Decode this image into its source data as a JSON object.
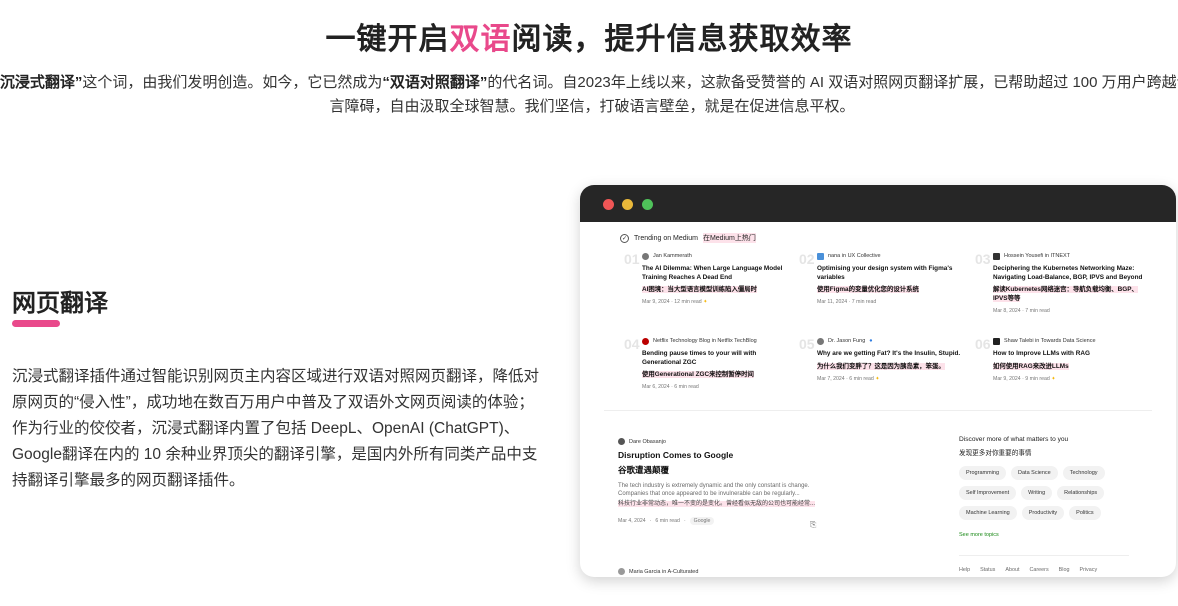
{
  "hero": {
    "title_a": "一键开启",
    "title_hl": "双语",
    "title_b": "阅读，提升信息获取效率",
    "desc_q1": "“沉浸式翻译”",
    "desc_1": "这个词，由我们发明创造。如今，它已然成为",
    "desc_q2": "“双语对照翻译”",
    "desc_2": "的代名词。自2023年上线以来，这款备受赞誉的 AI 双语对照网页翻译扩展，已帮助超过 100 万用户跨越语言障碍，自由汲取全球智慧。我们坚信，打破语言壁垒，就是在促进信息平权。"
  },
  "feature": {
    "title": "网页翻译",
    "desc": "沉浸式翻译插件通过智能识别网页主内容区域进行双语对照网页翻译，降低对原网页的“侵入性”，成功地在数百万用户中普及了双语外文网页阅读的体验；作为行业的佼佼者，沉浸式翻译内置了包括 DeepL、OpenAI (ChatGPT)、Google翻译在内的 10 余种业界顶尖的翻译引擎，是国内外所有同类产品中支持翻译引擎最多的网页翻译插件。",
    "accent_color": "#e9498b"
  },
  "browser": {
    "trending_label": "Trending on Medium",
    "trending_trans": "在Medium上热门",
    "posts": [
      {
        "num": "01",
        "author": "Jan Kammerath",
        "title": "The AI Dilemma: When Large Language Model Training Reaches A Dead End",
        "trans": "AI困境：当大型语言模型训练陷入僵局时",
        "meta": "Mar 9, 2024 · 12 min read"
      },
      {
        "num": "02",
        "author": "nana in UX Collective",
        "title": "Optimising your design system with Figma's variables",
        "trans": "使用Figma的变量优化您的设计系统",
        "meta": "Mar 11, 2024 · 7 min read"
      },
      {
        "num": "03",
        "author": "Hossein Yousefi in ITNEXT",
        "title": "Deciphering the Kubernetes Networking Maze: Navigating Load-Balance, BGP, IPVS and Beyond",
        "trans": "解读Kubernetes网络迷宫：导航负载均衡、BGP、IPVS等等",
        "meta": "Mar 8, 2024 · 7 min read"
      },
      {
        "num": "04",
        "author": "Netflix Technology Blog in Netflix TechBlog",
        "title": "Bending pause times to your will with Generational ZGC",
        "trans": "使用Generational ZGC来控制暂停时间",
        "meta": "Mar 6, 2024 · 6 min read"
      },
      {
        "num": "05",
        "author": "Dr. Jason Fung",
        "title": "Why are we getting Fat? It's the Insulin, Stupid.",
        "trans": "为什么我们变胖了？这是因为胰岛素，笨蛋。",
        "meta": "Mar 7, 2024 · 6 min read"
      },
      {
        "num": "06",
        "author": "Shaw Talebi in Towards Data Science",
        "title": "How to Improve LLMs with RAG",
        "trans": "如何使用RAG来改进LLMs",
        "meta": "Mar 9, 2024 · 9 min read"
      }
    ],
    "article": {
      "author": "Dare Obasanjo",
      "title": "Disruption Comes to Google",
      "trans": "谷歌遭遇颠覆",
      "excerpt": "The tech industry is extremely dynamic and the only constant is change. Companies that once appeared to be invulnerable can be regularly...",
      "excerpt_trans": "科技行业非常动态，唯一不变的是变化。曾经看似无敌的公司也可能经常...",
      "date": "Mar 4, 2024",
      "read": "6 min read",
      "tag": "Google"
    },
    "next_author": "Maria Garcia in A-Culturated",
    "discover": {
      "title": "Discover more of what matters to you",
      "trans": "发现更多对你重要的事情",
      "topics": [
        "Programming",
        "Data Science",
        "Technology",
        "Self Improvement",
        "Writing",
        "Relationships",
        "Machine Learning",
        "Productivity",
        "Politics"
      ],
      "see_more": "See more topics"
    },
    "footer": [
      "Help",
      "Status",
      "About",
      "Careers",
      "Blog",
      "Privacy"
    ]
  }
}
